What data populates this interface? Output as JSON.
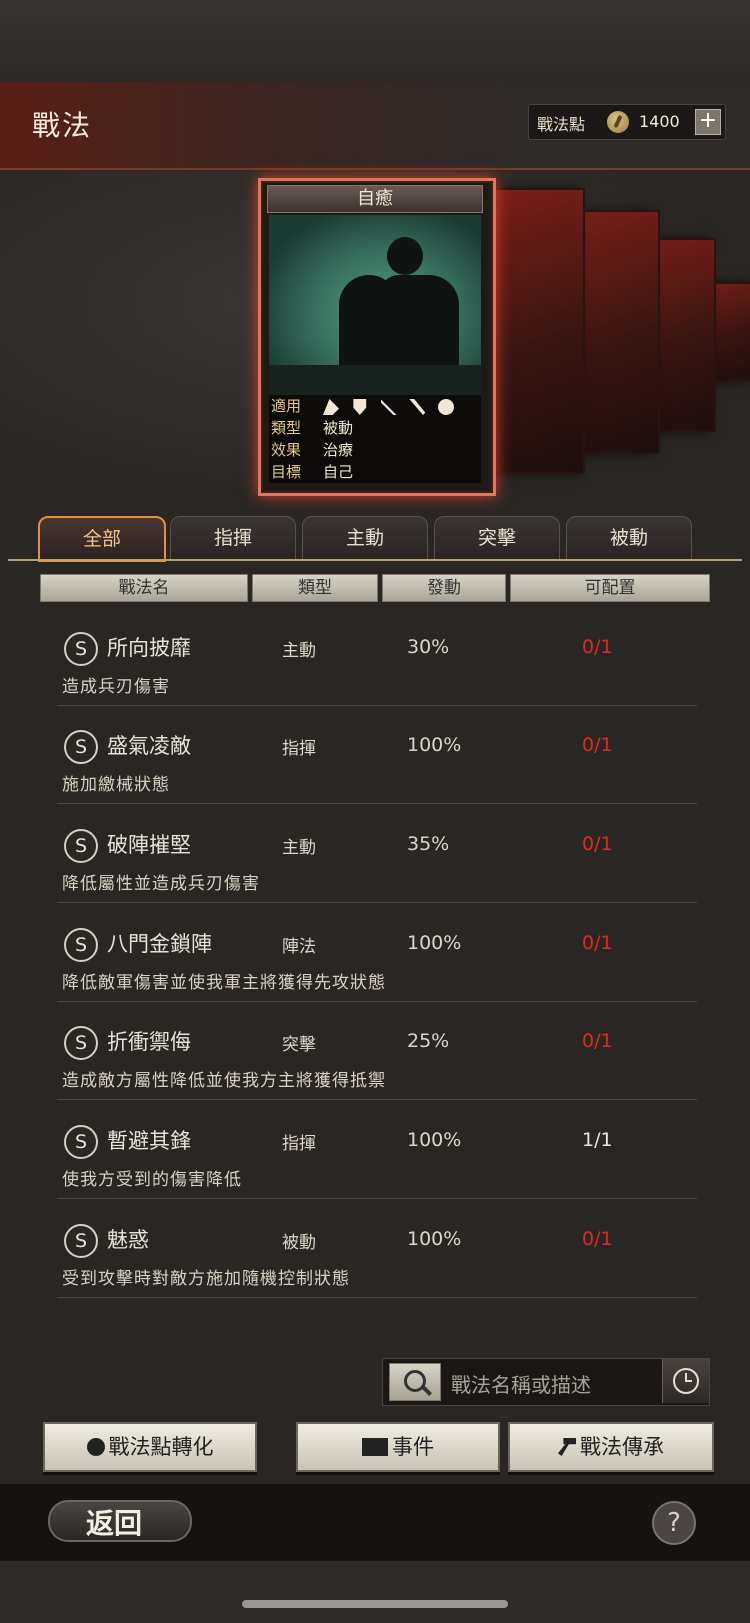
{
  "header": {
    "title": "戰法",
    "points_label": "戰法點",
    "points_value": "1400",
    "plus": "+"
  },
  "featured_card": {
    "name": "自癒",
    "rows": [
      {
        "key": "適用",
        "value": ""
      },
      {
        "key": "類型",
        "value": "被動"
      },
      {
        "key": "效果",
        "value": "治療"
      },
      {
        "key": "目標",
        "value": "自己"
      }
    ],
    "troop_icons": [
      "cavalry-icon",
      "shield-icon",
      "bow-icon",
      "spear-icon",
      "siege-icon"
    ]
  },
  "tabs": [
    "全部",
    "指揮",
    "主動",
    "突擊",
    "被動"
  ],
  "active_tab": "全部",
  "columns": [
    "戰法名",
    "類型",
    "發動",
    "可配置"
  ],
  "rows": [
    {
      "grade": "S",
      "name": "所向披靡",
      "type": "主動",
      "rate": "30%",
      "slots": "0/1",
      "desc": "造成兵刃傷害",
      "slots_color": "#e02a20"
    },
    {
      "grade": "S",
      "name": "盛氣凌敵",
      "type": "指揮",
      "rate": "100%",
      "slots": "0/1",
      "desc": "施加繳械狀態",
      "slots_color": "#e02a20"
    },
    {
      "grade": "S",
      "name": "破陣摧堅",
      "type": "主動",
      "rate": "35%",
      "slots": "0/1",
      "desc": "降低屬性並造成兵刃傷害",
      "slots_color": "#e02a20"
    },
    {
      "grade": "S",
      "name": "八門金鎖陣",
      "type": "陣法",
      "rate": "100%",
      "slots": "0/1",
      "desc": "降低敵軍傷害並使我軍主將獲得先攻狀態",
      "slots_color": "#e02a20"
    },
    {
      "grade": "S",
      "name": "折衝禦侮",
      "type": "突擊",
      "rate": "25%",
      "slots": "0/1",
      "desc": "造成敵方屬性降低並使我方主將獲得抵禦",
      "slots_color": "#e02a20"
    },
    {
      "grade": "S",
      "name": "暫避其鋒",
      "type": "指揮",
      "rate": "100%",
      "slots": "1/1",
      "desc": "使我方受到的傷害降低",
      "slots_color": "#ece6da"
    },
    {
      "grade": "S",
      "name": "魅惑",
      "type": "被動",
      "rate": "100%",
      "slots": "0/1",
      "desc": "受到攻擊時對敵方施加隨機控制狀態",
      "slots_color": "#e02a20"
    }
  ],
  "search": {
    "placeholder": "戰法名稱或描述"
  },
  "buttons": {
    "convert": "戰法點轉化",
    "event": "事件",
    "inherit": "戰法傳承"
  },
  "footer": {
    "back": "返回",
    "help": "?"
  }
}
